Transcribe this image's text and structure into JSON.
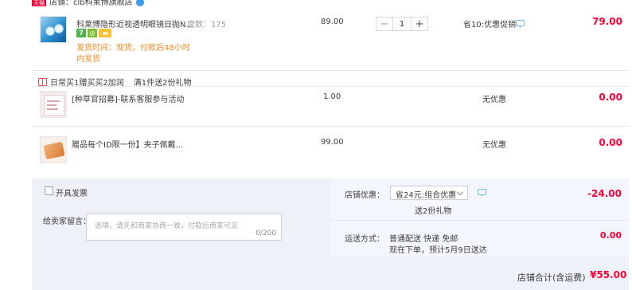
{
  "shop": {
    "badge": "天猫",
    "name": "店铺：clb科莱博旗舰店"
  },
  "items": [
    {
      "title": "科莱博隐形近视透明眼镜日抛N...",
      "sku": "度数：175",
      "shipping_note_line1": "发货时间：现货，付款后48小时",
      "shipping_note_line2": "内发货",
      "price": "89.00",
      "quantity": "1",
      "promo": "省10:优惠促销",
      "total": "79.00"
    },
    {
      "title": "[种草官招募]-联系客服参与活动",
      "price": "1.00",
      "promo": "无优惠",
      "total": "0.00"
    },
    {
      "title": "赠品每个ID限一份】夹子佩戴...",
      "price": "99.00",
      "promo": "无优惠",
      "total": "0.00"
    }
  ],
  "gift": {
    "bar1": "日常买1赠买买2加润",
    "bar2": "满1件送2份礼物"
  },
  "summary": {
    "invoice_label": "开具发票",
    "memo_label": "给卖家留言：",
    "memo_placeholder": "选填，请先和商家协商一致，付款后商家可见",
    "memo_count": "0/200",
    "shop_discount_label": "店铺优惠：",
    "shop_discount_option": "省24元:组合优惠",
    "shop_discount_sub": "送2份礼物",
    "shop_discount_amount": "-24.00",
    "delivery_label": "运送方式：",
    "delivery_method": "普通配送 快递 免邮",
    "delivery_eta": "现在下单，预计5月9日送达",
    "delivery_amount": "0.00",
    "total_label": "店铺合计(含运费)",
    "total_value": "¥55.00"
  }
}
